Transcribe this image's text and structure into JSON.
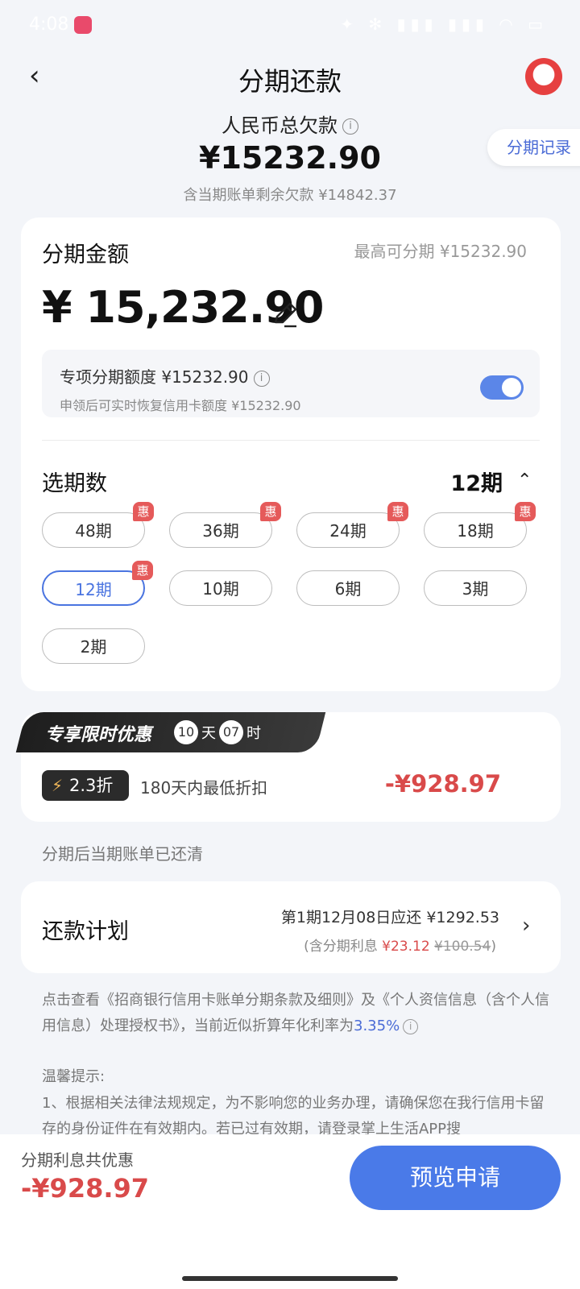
{
  "status_bar": {
    "time": "4:08",
    "icons": "✦ ✻ ▮▮▮ ▮▮▮ ◠ ▭"
  },
  "header": {
    "back_icon": "‹",
    "title": "分期还款",
    "record_button": "分期记录"
  },
  "summary": {
    "total_debt_label": "人民币总欠款",
    "total_debt": "¥15232.90",
    "remaining": "含当期账单剩余欠款 ¥14842.37"
  },
  "amount": {
    "label": "分期金额",
    "max_label": "最高可分期 ¥15232.90",
    "value": "¥ 15,232.90"
  },
  "quota": {
    "title": "专项分期额度 ¥15232.90",
    "subtitle": "申领后可实时恢复信用卡额度 ¥15232.90",
    "toggle_on": true
  },
  "periods": {
    "label": "选期数",
    "selected": "12期",
    "badge": "惠",
    "options": [
      {
        "label": "48期",
        "badge": true
      },
      {
        "label": "36期",
        "badge": true
      },
      {
        "label": "24期",
        "badge": true
      },
      {
        "label": "18期",
        "badge": true
      },
      {
        "label": "12期",
        "badge": true,
        "selected": true
      },
      {
        "label": "10期",
        "badge": false
      },
      {
        "label": "6期",
        "badge": false
      },
      {
        "label": "3期",
        "badge": false
      },
      {
        "label": "2期",
        "badge": false
      }
    ]
  },
  "promo": {
    "title": "专享限时优惠",
    "days": "10",
    "days_unit": "天",
    "hours": "07",
    "hours_unit": "时",
    "discount_tag": "2.3折",
    "discount_desc": "180天内最低折扣",
    "discount_amount": "-¥928.97"
  },
  "cleared_note": "分期后当期账单已还清",
  "plan": {
    "label": "还款计划",
    "line1": "第1期12月08日应还 ¥1292.53",
    "line2_prefix": "(含分期利息 ",
    "line2_interest": "¥23.12",
    "line2_original": "¥100.54",
    "line2_suffix": ")"
  },
  "terms": {
    "text": "点击查看《招商银行信用卡账单分期条款及细则》及《个人资信信息（含个人信用信息）处理授权书》，当前近似折算年化利率为",
    "rate": "3.35%"
  },
  "tips": {
    "title": "温馨提示:",
    "body": "1、根据相关法律法规规定，为不影响您的业务办理，请确保您在我行信用卡留存的身份证件在有效期内。若已过有效期，请登录掌上生活APP搜"
  },
  "bottom": {
    "save_label": "分期利息共优惠",
    "save_amount": "-¥928.97",
    "apply_button": "预览申请"
  },
  "colors": {
    "accent": "#4a7ae8",
    "discount_red": "#d94a4a",
    "badge_red": "#e55a5a"
  }
}
